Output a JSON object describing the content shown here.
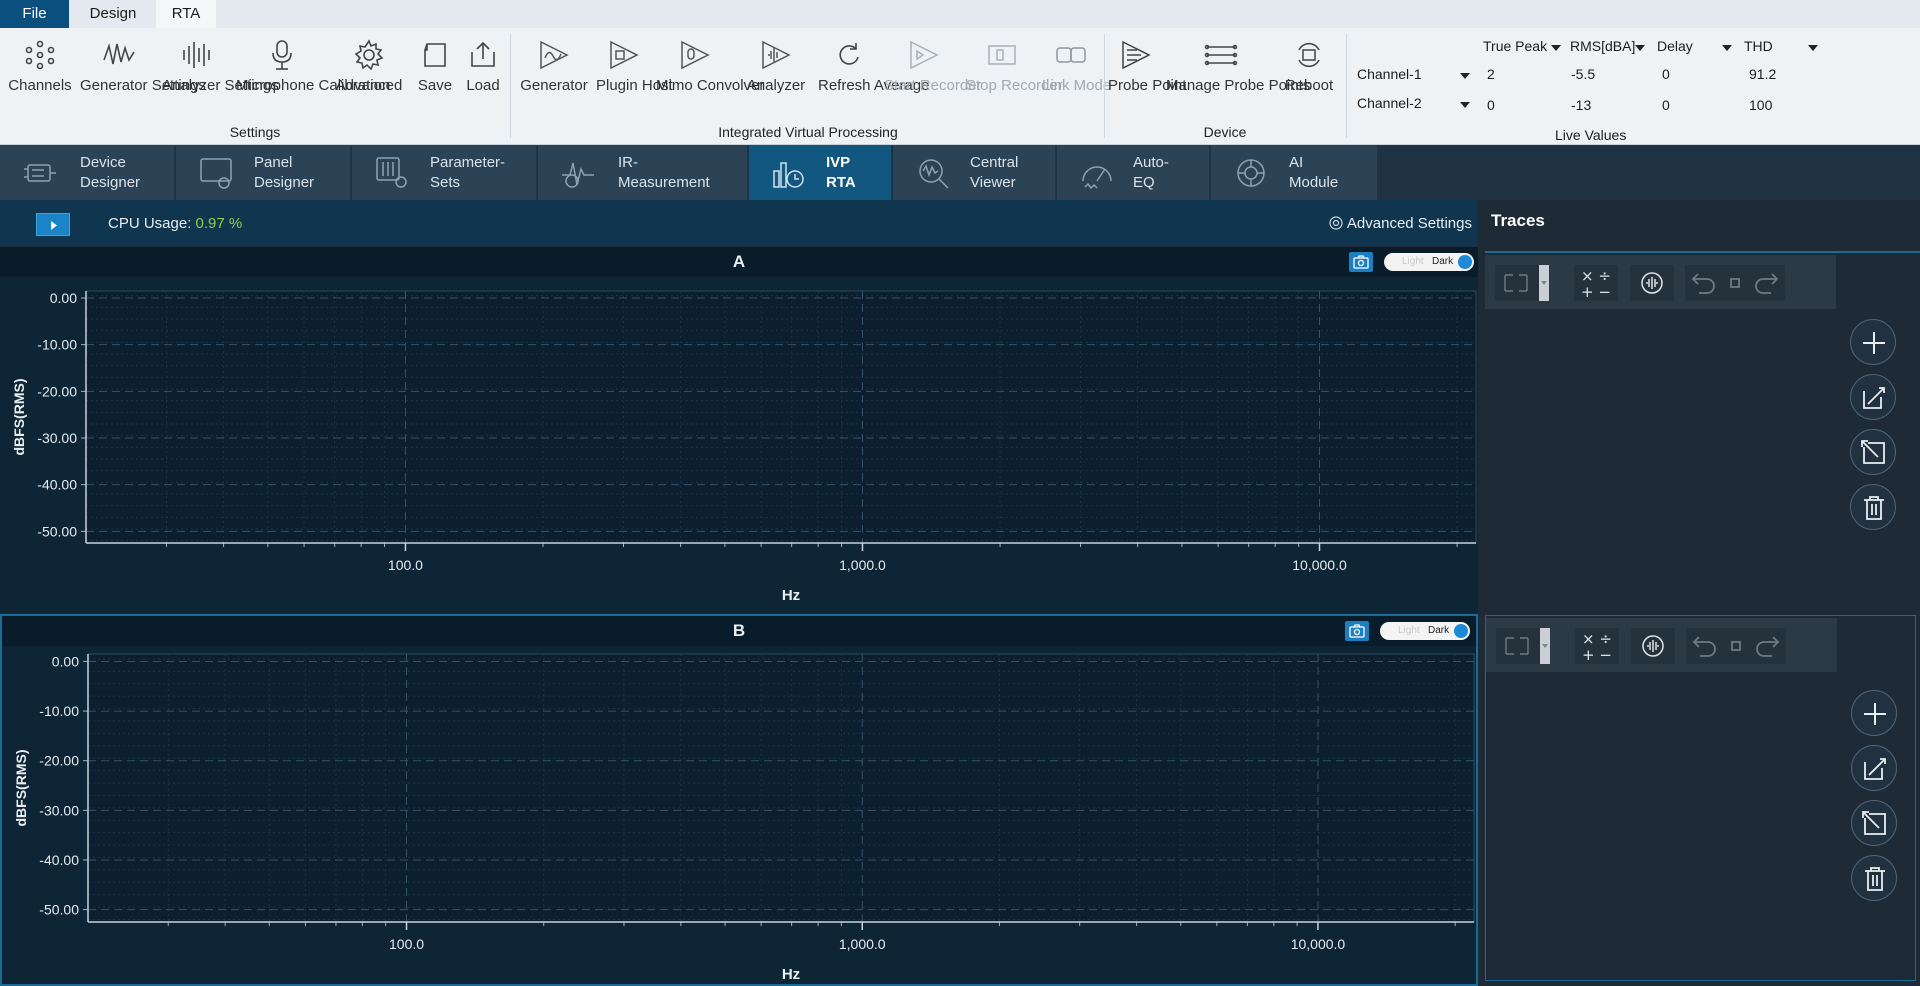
{
  "menu": {
    "tabs": [
      "File",
      "Design",
      "RTA"
    ]
  },
  "ribbon": {
    "settings": {
      "label": "Settings",
      "buttons": [
        "Channels",
        "Generator\nSettings",
        "Analyzer\nSettings",
        "Microphone\nCalibration",
        "Advanced",
        "Save",
        "Load"
      ]
    },
    "ivp": {
      "label": "Integrated Virtual Processing",
      "buttons": [
        "Generator",
        "Plugin\nHost",
        "Mimo\nConvolver",
        "Analyzer",
        "Refresh\nAverage",
        "Start\nRecorder",
        "Stop\nRecorder",
        "Link\nMode"
      ]
    },
    "device": {
      "label": "Device",
      "buttons": [
        "Probe\nPoint",
        "Manage Probe\nPoints",
        "Reboot"
      ]
    },
    "live_values": {
      "label": "Live Values",
      "headers": [
        "True Peak",
        "RMS[dBA]",
        "Delay",
        "THD"
      ],
      "rows": [
        {
          "channel": "Channel-1",
          "values": [
            "2",
            "-5.5",
            "0",
            "91.2"
          ]
        },
        {
          "channel": "Channel-2",
          "values": [
            "0",
            "-13",
            "0",
            "100"
          ]
        }
      ]
    }
  },
  "module_tabs": [
    {
      "label": "Device\nDesigner",
      "icon": "device-designer-icon"
    },
    {
      "label": "Panel\nDesigner",
      "icon": "panel-designer-icon"
    },
    {
      "label": "Parameter-\nSets",
      "icon": "parameter-sets-icon"
    },
    {
      "label": "IR-\nMeasurement",
      "icon": "ir-measurement-icon"
    },
    {
      "label": "IVP\nRTA",
      "icon": "ivp-rta-icon",
      "active": true
    },
    {
      "label": "Central\nViewer",
      "icon": "central-viewer-icon"
    },
    {
      "label": "Auto-\nEQ",
      "icon": "auto-eq-icon"
    },
    {
      "label": "AI\nModule",
      "icon": "ai-module-icon"
    }
  ],
  "control_bar": {
    "cpu_label": "CPU Usage: ",
    "cpu_value": "0.97 %",
    "advanced_settings": "Advanced Settings"
  },
  "traces": {
    "title": "Traces"
  },
  "theme_toggle": {
    "light": "Light",
    "dark": "Dark"
  },
  "colors": {
    "accent": "#1a84c7",
    "active_tab": "#12577f",
    "cpu_value": "#8fd04b",
    "plot_bg": "#0e2536"
  },
  "chart_data": [
    {
      "type": "line",
      "title": "A",
      "xlabel": "Hz",
      "ylabel": "dBFS(RMS)",
      "xscale": "log",
      "xlim": [
        20,
        22000
      ],
      "xticks": [
        100,
        1000,
        10000
      ],
      "xtick_labels": [
        "100.0",
        "1,000.0",
        "10,000.0"
      ],
      "ylim": [
        -52.5,
        1.5
      ],
      "yticks": [
        0,
        -10,
        -20,
        -30,
        -40,
        -50
      ],
      "ytick_labels": [
        "0.00",
        "-10.00",
        "-20.00",
        "-30.00",
        "-40.00",
        "-50.00"
      ],
      "grid": true,
      "series": []
    },
    {
      "type": "line",
      "title": "B",
      "xlabel": "Hz",
      "ylabel": "dBFS(RMS)",
      "xscale": "log",
      "xlim": [
        20,
        22000
      ],
      "xticks": [
        100,
        1000,
        10000
      ],
      "xtick_labels": [
        "100.0",
        "1,000.0",
        "10,000.0"
      ],
      "ylim": [
        -52.5,
        1.5
      ],
      "yticks": [
        0,
        -10,
        -20,
        -30,
        -40,
        -50
      ],
      "ytick_labels": [
        "0.00",
        "-10.00",
        "-20.00",
        "-30.00",
        "-40.00",
        "-50.00"
      ],
      "grid": true,
      "series": []
    }
  ]
}
